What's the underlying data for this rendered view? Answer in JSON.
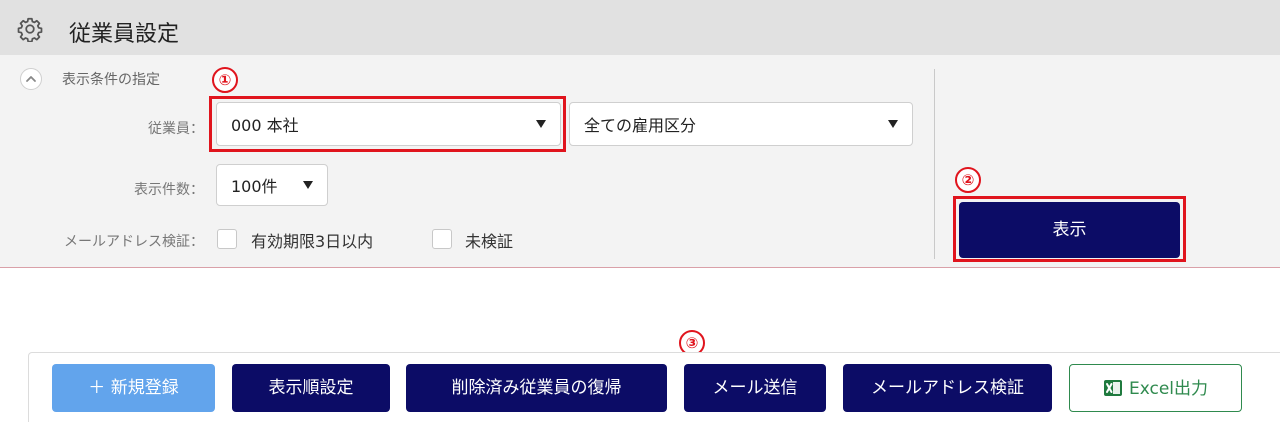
{
  "header": {
    "title": "従業員設定",
    "icon": "gear-icon"
  },
  "filter": {
    "section_label": "表示条件の指定",
    "employee_label": "従業員：",
    "employee_value": "000 本社",
    "employment_type_value": "全ての雇用区分",
    "count_label": "表示件数：",
    "count_value": "100件",
    "email_label": "メールアドレス検証：",
    "check_expiry_label": "有効期限3日以内",
    "check_unverified_label": "未検証",
    "show_button": "表示"
  },
  "annotations": [
    "①",
    "②",
    "③"
  ],
  "toolbar": {
    "new_button": "＋ 新規登録",
    "order_button": "表示順設定",
    "restore_button": "削除済み従業員の復帰",
    "mail_button": "メール送信",
    "verify_button": "メールアドレス検証",
    "excel_button": "Excel出力"
  },
  "colors": {
    "primary": "#0c0c66",
    "new": "#62a4ec",
    "excel": "#2f8a4e",
    "highlight": "#e0141d"
  }
}
